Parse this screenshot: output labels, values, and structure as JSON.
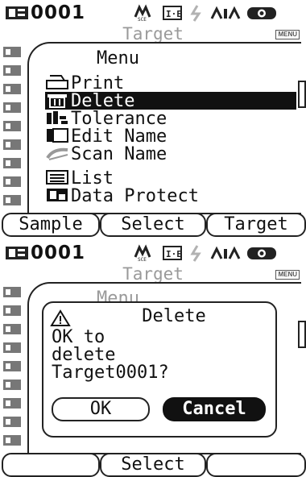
{
  "screen1": {
    "status": {
      "id": "0001"
    },
    "subheader": {
      "title": "Target",
      "menu_badge": "MENU"
    },
    "menu": {
      "title": "Menu",
      "items": [
        {
          "label": "Print",
          "icon": "printer-icon"
        },
        {
          "label": "Delete",
          "icon": "trash-icon",
          "selected": true
        },
        {
          "label": "Tolerance",
          "icon": "tolerance-icon"
        },
        {
          "label": "Edit Name",
          "icon": "document-icon"
        },
        {
          "label": "Scan Name",
          "icon": "scan-icon"
        },
        {
          "label": "List",
          "icon": "list-icon"
        },
        {
          "label": "Data Protect",
          "icon": "protect-icon"
        }
      ]
    },
    "softkeys": [
      "Sample",
      "Select",
      "Target"
    ]
  },
  "screen2": {
    "status": {
      "id": "0001"
    },
    "subheader": {
      "title": "Target",
      "menu_badge": "MENU"
    },
    "menu": {
      "title": "Menu"
    },
    "dialog": {
      "title": "Delete",
      "icon": "warning-icon",
      "message_lines": [
        "OK to",
        "delete",
        "Target0001?"
      ],
      "ok_label": "OK",
      "cancel_label": "Cancel"
    },
    "softkeys": [
      "",
      "Select",
      ""
    ]
  },
  "colors": {
    "text": "#111111",
    "dim_text": "#9a9a9a",
    "selection": "#111111"
  }
}
